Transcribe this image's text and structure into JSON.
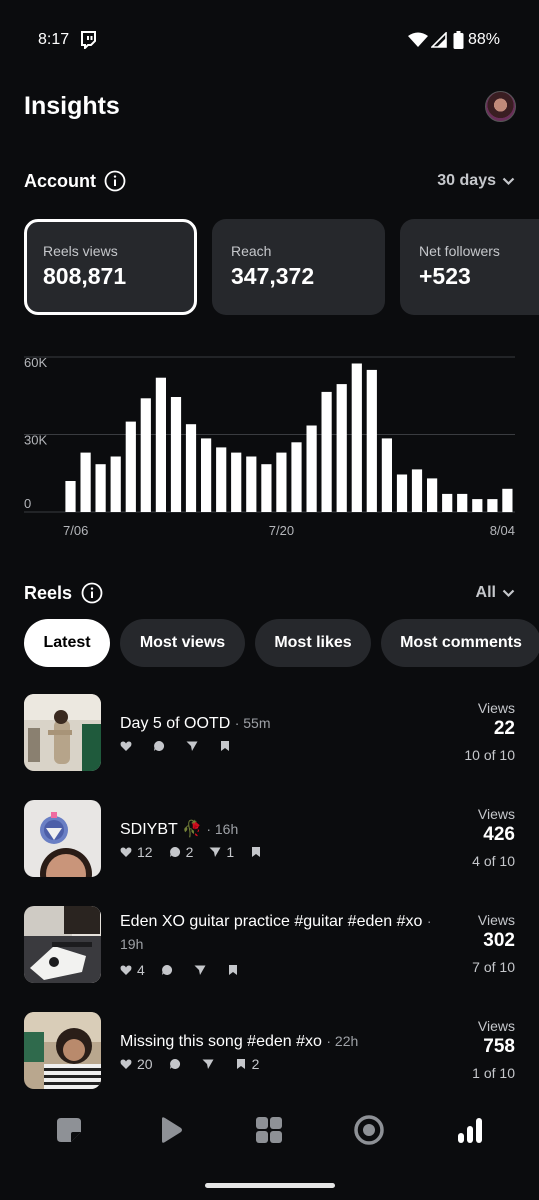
{
  "status_bar": {
    "time": "8:17",
    "battery": "88%"
  },
  "header": {
    "title": "Insights"
  },
  "account": {
    "title": "Account",
    "range": "30 days",
    "cards": [
      {
        "label": "Reels views",
        "value": "808,871"
      },
      {
        "label": "Reach",
        "value": "347,372"
      },
      {
        "label": "Net followers",
        "value": "+523"
      }
    ]
  },
  "chart_data": {
    "type": "bar",
    "x_tick_labels": [
      "7/06",
      "7/20",
      "8/04"
    ],
    "y_tick_labels": [
      "60K",
      "30K",
      "0"
    ],
    "ylim": [
      0,
      60000
    ],
    "values": [
      12000,
      23000,
      18500,
      21500,
      35000,
      44000,
      52000,
      44500,
      34000,
      28500,
      25000,
      23000,
      21500,
      18500,
      23000,
      27000,
      33500,
      46500,
      49500,
      57500,
      55000,
      28500,
      14500,
      16500,
      13000,
      7000,
      7000,
      5000,
      5000,
      9000
    ],
    "grid": true,
    "colors": {
      "bar": "#ffffff",
      "grid": "#3a3c40"
    }
  },
  "reels_section": {
    "title": "Reels",
    "filter": "All",
    "chips": [
      "Latest",
      "Most views",
      "Most likes",
      "Most comments"
    ],
    "active_chip": "Latest"
  },
  "reels": [
    {
      "title": "Day 5 of OOTD",
      "time": "· 55m",
      "likes": "",
      "comments": "",
      "shares": "",
      "saves": "",
      "views_label": "Views",
      "views": "22",
      "rank": "10 of 10"
    },
    {
      "title": "SDIYBT 🥀",
      "time": "· 16h",
      "likes": "12",
      "comments": "2",
      "shares": "1",
      "saves": "",
      "views_label": "Views",
      "views": "426",
      "rank": "4 of 10"
    },
    {
      "title": "Eden XO guitar practice #guitar #eden #xo",
      "time": "· 19h",
      "likes": "4",
      "comments": "",
      "shares": "",
      "saves": "",
      "views_label": "Views",
      "views": "302",
      "rank": "7 of 10"
    },
    {
      "title": "Missing this song #eden #xo",
      "time": "· 22h",
      "likes": "20",
      "comments": "",
      "shares": "",
      "saves": "2",
      "views_label": "Views",
      "views": "758",
      "rank": "1 of 10"
    }
  ],
  "bottom_nav": [
    "posts-icon",
    "reels-icon",
    "apps-icon",
    "record-icon",
    "insights-icon"
  ]
}
